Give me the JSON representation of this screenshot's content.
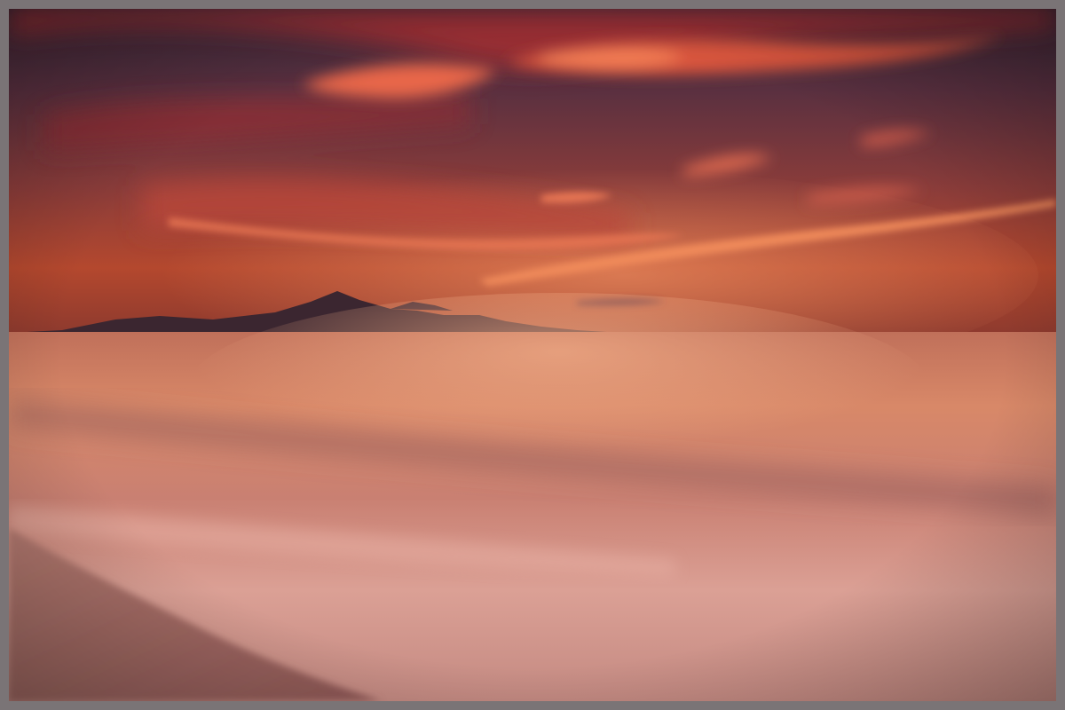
{
  "scene": {
    "subject": "sunset-over-sea-with-island-silhouette",
    "colors": {
      "sky_top": "#3a2a3e",
      "sky_mid": "#7a3e44",
      "sky_horizon": "#c4553a",
      "cloud_bright": "#f07a52",
      "cloud_red": "#c23a32",
      "mountain": "#3b2630",
      "sea_far": "#d88a68",
      "sea_near": "#e0a694",
      "sand": "#b97a72",
      "frame": "#7a7476"
    }
  }
}
